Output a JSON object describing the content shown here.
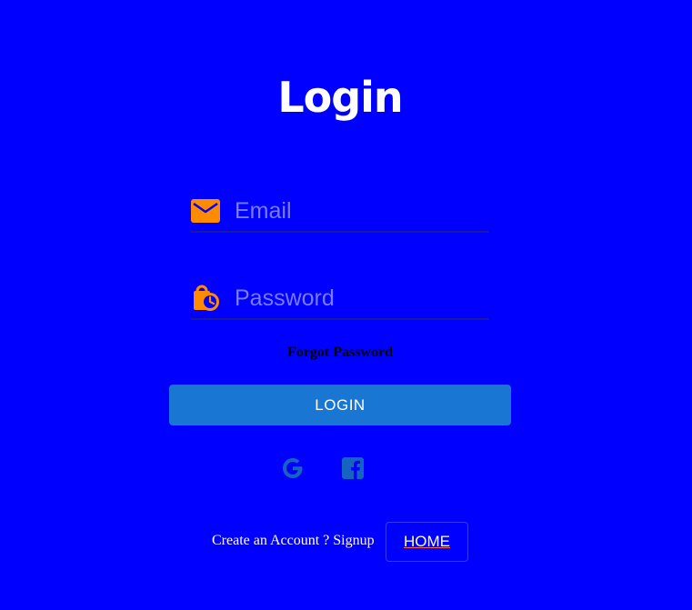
{
  "page": {
    "title": "Login"
  },
  "form": {
    "email_placeholder": "Email",
    "email_value": "",
    "email_icon": "mail-icon",
    "password_placeholder": "Password",
    "password_value": "",
    "password_icon": "lock-clock-icon",
    "forgot_label": "Forgot Password",
    "login_label": "LOGIN"
  },
  "social": {
    "google_icon": "google-icon",
    "facebook_icon": "facebook-icon"
  },
  "footer": {
    "signup_text": "Create an Account ? Signup",
    "home_label": "HOME"
  },
  "colors": {
    "background": "#0000ff",
    "icon_accent": "#ff8c00",
    "button": "#1976d2",
    "social_icon": "#1565c0"
  }
}
